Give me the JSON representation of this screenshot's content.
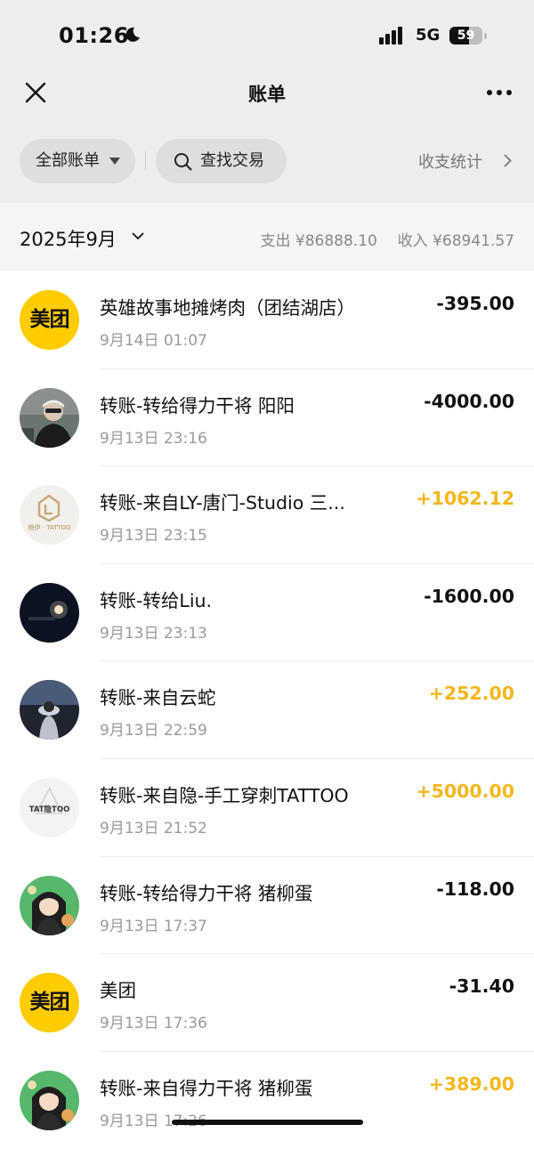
{
  "status_bar": {
    "time": "01:26",
    "network": "5G",
    "battery": "59",
    "battery_level": 0.59
  },
  "nav": {
    "title": "账单"
  },
  "filters": {
    "all_bills": "全部账单",
    "search": "查找交易",
    "stats": "收支统计"
  },
  "month": {
    "label": "2025年9月",
    "expense_label": "支出",
    "expense_value": "¥86888.10",
    "income_label": "收入",
    "income_value": "¥68941.57"
  },
  "transactions": [
    {
      "title": "英雄故事地摊烤肉（团结湖店）",
      "date": "9月14日 01:07",
      "amount": "-395.00",
      "type": "expense",
      "avatar": "meituan-logo",
      "avatar_text": "美团"
    },
    {
      "title": "转账-转给得力干将 阳阳",
      "date": "9月13日 23:16",
      "amount": "-4000.00",
      "type": "expense",
      "avatar": "photo-person"
    },
    {
      "title": "转账-来自LY-唐门-Studio 三...",
      "date": "9月13日 23:15",
      "amount": "+1062.12",
      "type": "income",
      "avatar": "tattoo-studio-logo",
      "avatar_text": "杨伊 · TATTOO"
    },
    {
      "title": "转账-转给Liu.",
      "date": "9月13日 23:13",
      "amount": "-1600.00",
      "type": "expense",
      "avatar": "photo-night"
    },
    {
      "title": "转账-来自云蛇",
      "date": "9月13日 22:59",
      "amount": "+252.00",
      "type": "income",
      "avatar": "photo-silhouette"
    },
    {
      "title": "转账-来自隐-手工穿刺TATTOO",
      "date": "9月13日 21:52",
      "amount": "+5000.00",
      "type": "income",
      "avatar": "tattoo-logo",
      "avatar_text": "TAT隐TOO"
    },
    {
      "title": "转账-转给得力干将 猪柳蛋",
      "date": "9月13日 17:37",
      "amount": "-118.00",
      "type": "expense",
      "avatar": "cartoon-green"
    },
    {
      "title": "美团",
      "date": "9月13日 17:36",
      "amount": "-31.40",
      "type": "expense",
      "avatar": "meituan-logo",
      "avatar_text": "美团"
    },
    {
      "title": "转账-来自得力干将 猪柳蛋",
      "date": "9月13日 17:26",
      "amount": "+389.00",
      "type": "income",
      "avatar": "cartoon-green"
    }
  ],
  "colors": {
    "income": "#f5b71c",
    "expense": "#111111",
    "meituan": "#ffcc00",
    "header_bg": "#ededed"
  }
}
